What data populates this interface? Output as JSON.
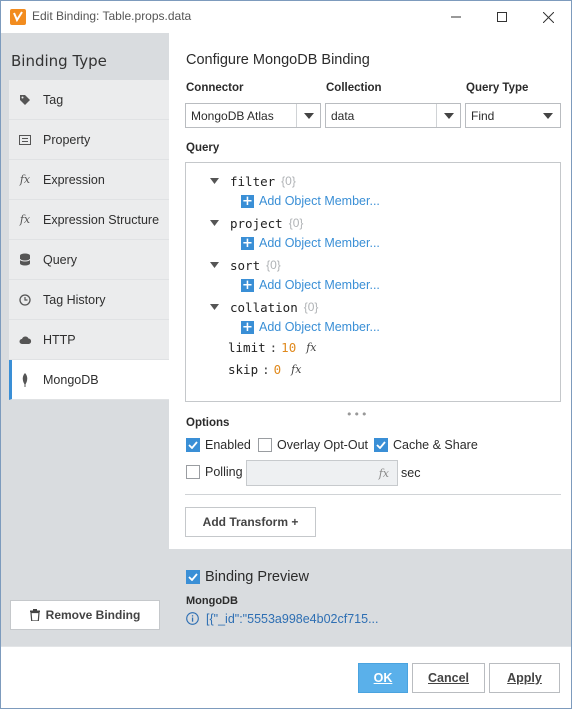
{
  "window": {
    "title": "Edit Binding: Table.props.data"
  },
  "left": {
    "heading": "Binding Type",
    "items": [
      {
        "label": "Tag",
        "icon": "tag-icon"
      },
      {
        "label": "Property",
        "icon": "property-icon"
      },
      {
        "label": "Expression",
        "icon": "fx-icon"
      },
      {
        "label": "Expression Structure",
        "icon": "fx-icon"
      },
      {
        "label": "Query",
        "icon": "database-icon"
      },
      {
        "label": "Tag History",
        "icon": "clock-icon"
      },
      {
        "label": "HTTP",
        "icon": "cloud-icon"
      },
      {
        "label": "MongoDB",
        "icon": "mongodb-leaf-icon",
        "active": true
      }
    ],
    "remove_label": "Remove Binding"
  },
  "config": {
    "title": "Configure MongoDB Binding",
    "connector_label": "Connector",
    "connector_value": "MongoDB Atlas",
    "collection_label": "Collection",
    "collection_value": "data",
    "querytype_label": "Query Type",
    "querytype_value": "Find",
    "query_label": "Query",
    "query": {
      "filter_key": "filter",
      "filter_count": "{0}",
      "project_key": "project",
      "project_count": "{0}",
      "sort_key": "sort",
      "sort_count": "{0}",
      "collation_key": "collation",
      "collation_count": "{0}",
      "add_member": "Add Object Member...",
      "limit_key": "limit",
      "limit_value": "10",
      "skip_key": "skip",
      "skip_value": "0",
      "colon": ":",
      "fx": "fx"
    },
    "options_label": "Options",
    "enabled_label": "Enabled",
    "overlay_label": "Overlay Opt-Out",
    "cache_label": "Cache & Share",
    "polling_label": "Polling",
    "polling_fx": "fx",
    "sec_label": "sec",
    "add_transform": "Add Transform +"
  },
  "preview": {
    "title": "Binding Preview",
    "subtitle": "MongoDB",
    "value": "[{\"_id\":\"5553a998e4b02cf715..."
  },
  "footer": {
    "ok": "OK",
    "cancel": "Cancel",
    "apply": "Apply"
  },
  "colors": {
    "accent": "#3a8fd6",
    "ok_button": "#5ab0ea",
    "panel": "#d9dcdf",
    "number": "#e08a1e"
  }
}
